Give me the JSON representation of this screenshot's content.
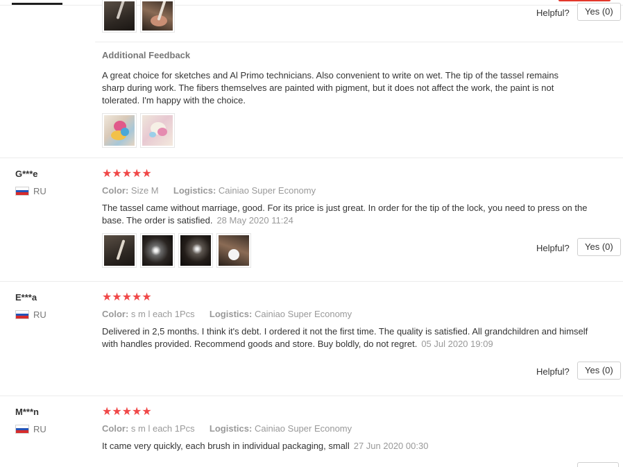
{
  "helpful_label": "Helpful?",
  "yes_label": "Yes (0)",
  "top_review": {
    "additional_feedback_title": "Additional Feedback",
    "additional_feedback_text": "A great choice for sketches and Al Primo technicians. Also convenient to write on wet. The tip of the tassel remains sharp during work. The fibers themselves are painted with pigment, but it does not affect the work, the paint is not tolerated. I'm happy with the choice."
  },
  "reviews": [
    {
      "user": "G***e",
      "country": "RU",
      "stars": "★★★★★",
      "color_label": "Color:",
      "color_value": "Size M",
      "logistics_label": "Logistics:",
      "logistics_value": "Cainiao Super Economy",
      "text": "The tassel came without marriage, good. For its price is just great. In order for the tip of the lock, you need to press on the base. The order is satisfied.",
      "date": "28 May 2020 11:24"
    },
    {
      "user": "E***a",
      "country": "RU",
      "stars": "★★★★★",
      "color_label": "Color:",
      "color_value": "s m l each 1Pcs",
      "logistics_label": "Logistics:",
      "logistics_value": "Cainiao Super Economy",
      "text": "Delivered in 2,5 months. I think it's debt. I ordered it not the first time. The quality is satisfied. All grandchildren and himself with handles provided. Recommend goods and store. Buy boldly, do not regret.",
      "date": "05 Jul 2020 19:09"
    },
    {
      "user": "M***n",
      "country": "RU",
      "stars": "★★★★★",
      "color_label": "Color:",
      "color_value": "s m l each 1Pcs",
      "logistics_label": "Logistics:",
      "logistics_value": "Cainiao Super Economy",
      "text": "It came very quickly, each brush in individual packaging, small",
      "date": "27 Jun 2020 00:30"
    }
  ],
  "colors": {
    "star": "#f04848",
    "accent_red": "#e2372b",
    "muted_text": "#999999"
  },
  "icons": {
    "star": "star-icon",
    "flag": "russia-flag-icon"
  }
}
